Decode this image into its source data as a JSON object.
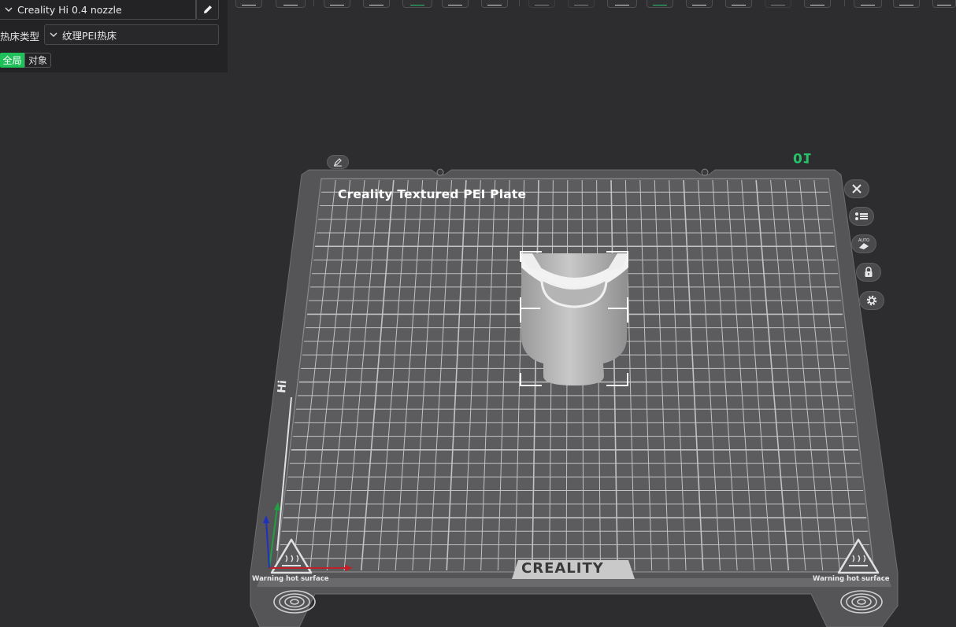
{
  "panel": {
    "printer_name": "Creality Hi 0.4 nozzle",
    "bed_type_label": "热床类型",
    "bed_type_value": "纹理PEI热床",
    "scope_global": "全局",
    "scope_object": "对象"
  },
  "plate": {
    "title": "Creality Textured PEI Plate",
    "number": "01",
    "brand": "CREALITY",
    "warning_left": "Warning hot surface",
    "warning_right": "Warning hot surface",
    "hi_mark": "Hi"
  },
  "colors": {
    "accent": "#1fbf5a",
    "plate_number": "#26c26a",
    "background": "#2d2d2f",
    "plate_surface": "#5a5a5c",
    "grid": "#d8d8d8",
    "model": "#bdbdbd"
  },
  "icons": {
    "edit": "pencil-icon",
    "close": "close-icon",
    "arrange": "list-icon",
    "auto_orient": "auto-orient-icon",
    "lock": "lock-icon",
    "settings": "gear-icon"
  }
}
